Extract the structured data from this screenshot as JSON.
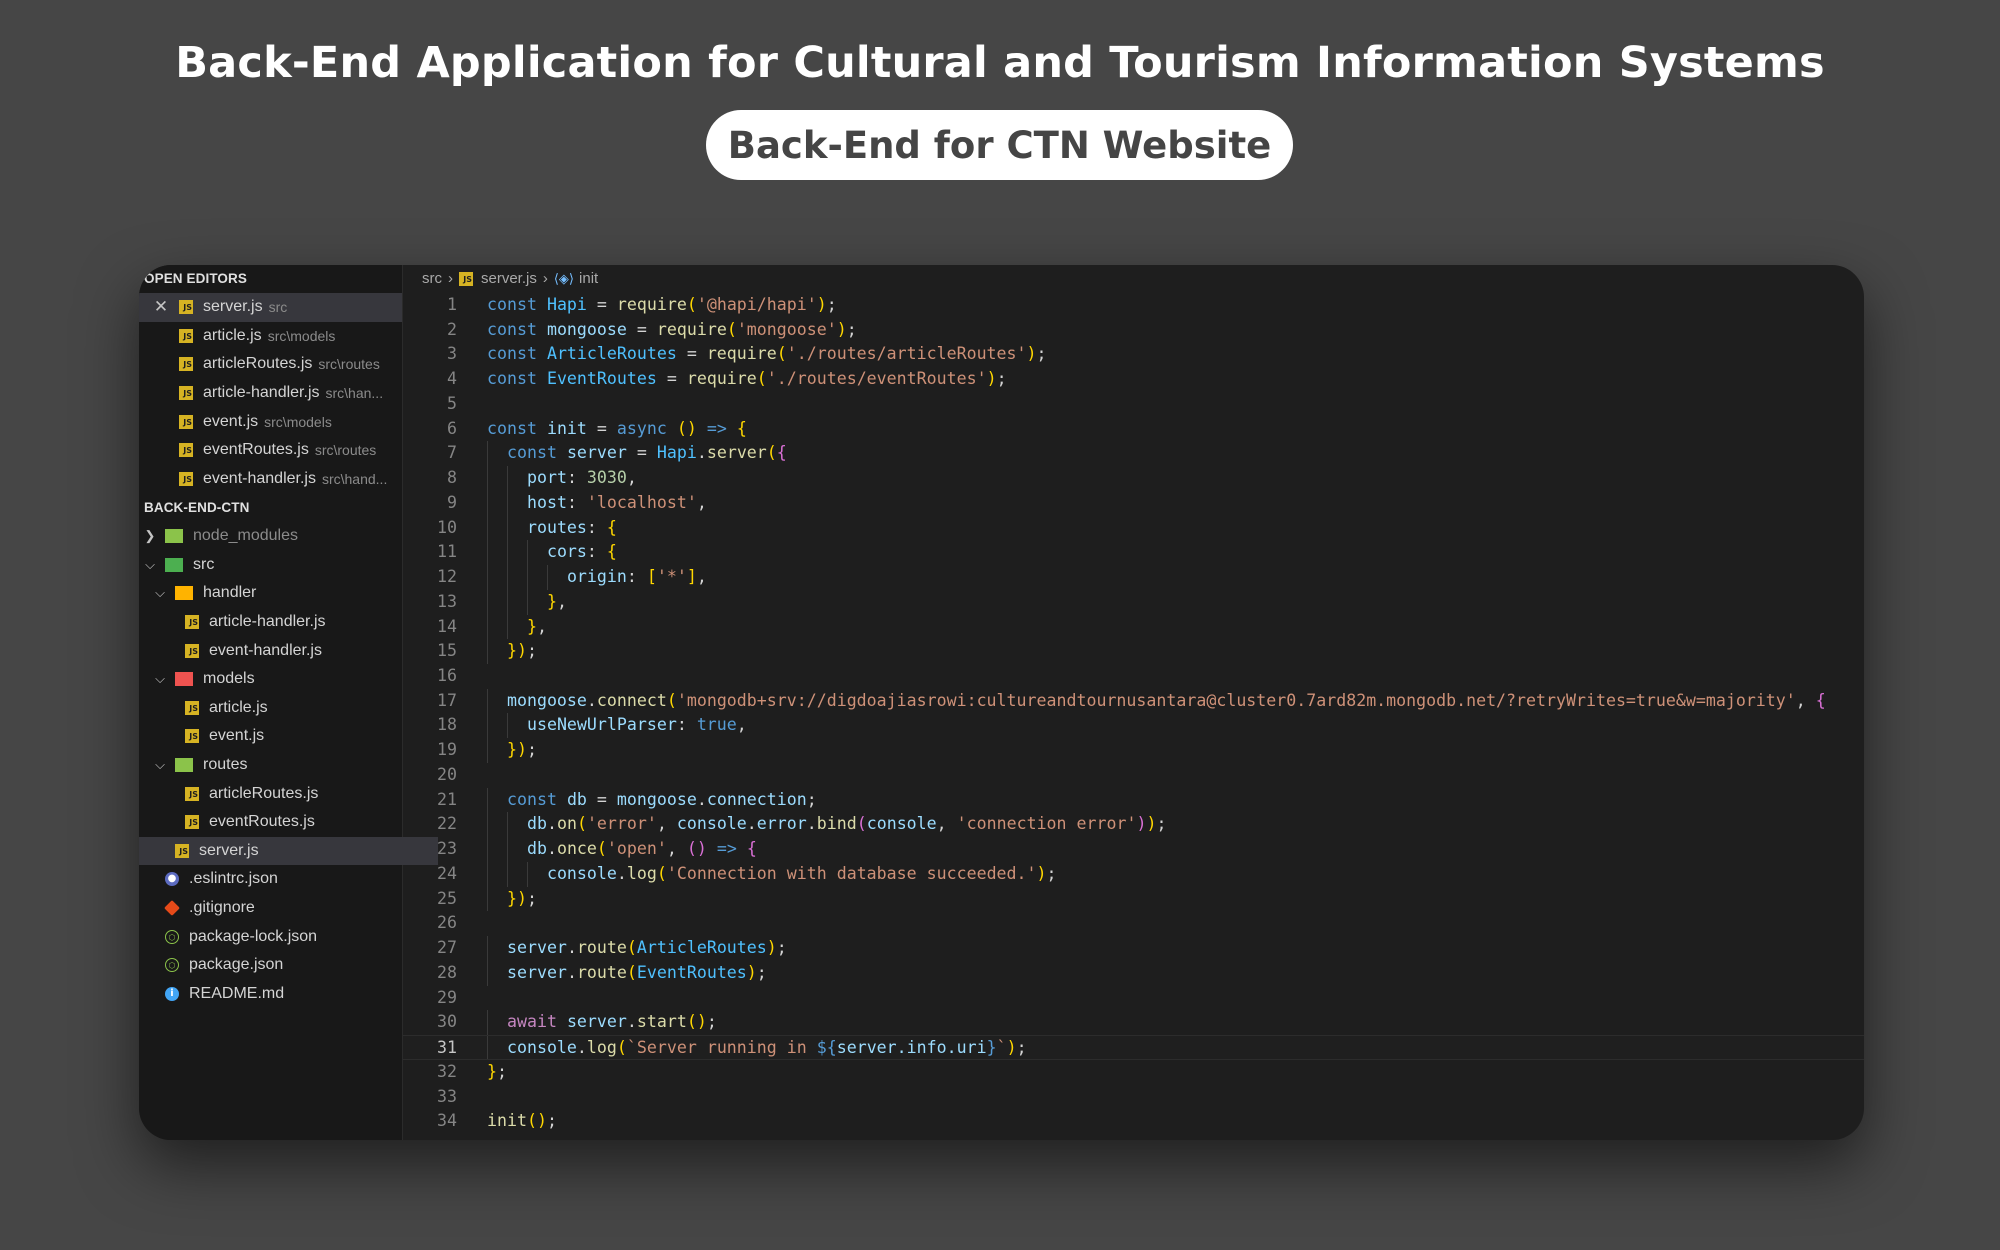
{
  "title": "Back-End Application for Cultural and Tourism Information Systems",
  "subtitle": "Back-End for CTN Website",
  "sidebar": {
    "open_editors_label": "OPEN EDITORS",
    "open_editors": [
      {
        "name": "server.js",
        "path": "src"
      },
      {
        "name": "article.js",
        "path": "src\\models"
      },
      {
        "name": "articleRoutes.js",
        "path": "src\\routes"
      },
      {
        "name": "article-handler.js",
        "path": "src\\han..."
      },
      {
        "name": "event.js",
        "path": "src\\models"
      },
      {
        "name": "eventRoutes.js",
        "path": "src\\routes"
      },
      {
        "name": "event-handler.js",
        "path": "src\\hand..."
      }
    ],
    "project_label": "BACK-END-CTN",
    "tree": {
      "node_modules": "node_modules",
      "src": "src",
      "handler": "handler",
      "article_handler": "article-handler.js",
      "event_handler": "event-handler.js",
      "models": "models",
      "article": "article.js",
      "event": "event.js",
      "routes": "routes",
      "article_routes": "articleRoutes.js",
      "event_routes": "eventRoutes.js",
      "server": "server.js",
      "eslintrc": ".eslintrc.json",
      "gitignore": ".gitignore",
      "package_lock": "package-lock.json",
      "package": "package.json",
      "readme": "README.md"
    }
  },
  "breadcrumb": {
    "folder": "src",
    "file": "server.js",
    "symbol": "init"
  },
  "code": {
    "current_line": 31,
    "lines": [
      "const Hapi = require('@hapi/hapi');",
      "const mongoose = require('mongoose');",
      "const ArticleRoutes = require('./routes/articleRoutes');",
      "const EventRoutes = require('./routes/eventRoutes');",
      "",
      "const init = async () => {",
      "  const server = Hapi.server({",
      "    port: 3030,",
      "    host: 'localhost',",
      "    routes: {",
      "      cors: {",
      "        origin: ['*'],",
      "      },",
      "    },",
      "  });",
      "",
      "  mongoose.connect('mongodb+srv://digdoajiasrowi:cultureandtournusantara@cluster0.7ard82m.mongodb.net/?retryWrites=true&w=majority', {",
      "    useNewUrlParser: true,",
      "  });",
      "",
      "  const db = mongoose.connection;",
      "    db.on('error', console.error.bind(console, 'connection error'));",
      "    db.once('open', () => {",
      "      console.log('Connection with database succeeded.');",
      "  });",
      "",
      "  server.route(ArticleRoutes);",
      "  server.route(EventRoutes);",
      "",
      "  await server.start();",
      "  console.log(`Server running in ${server.info.uri}`);",
      "};",
      "",
      "init();"
    ]
  },
  "colors": {
    "background": "#464646",
    "editor": "#1e1e1e",
    "sidebar": "#181818",
    "keyword": "#569cd6",
    "string": "#ce9178",
    "function": "#dcdcaa",
    "variable": "#9cdcfe"
  }
}
